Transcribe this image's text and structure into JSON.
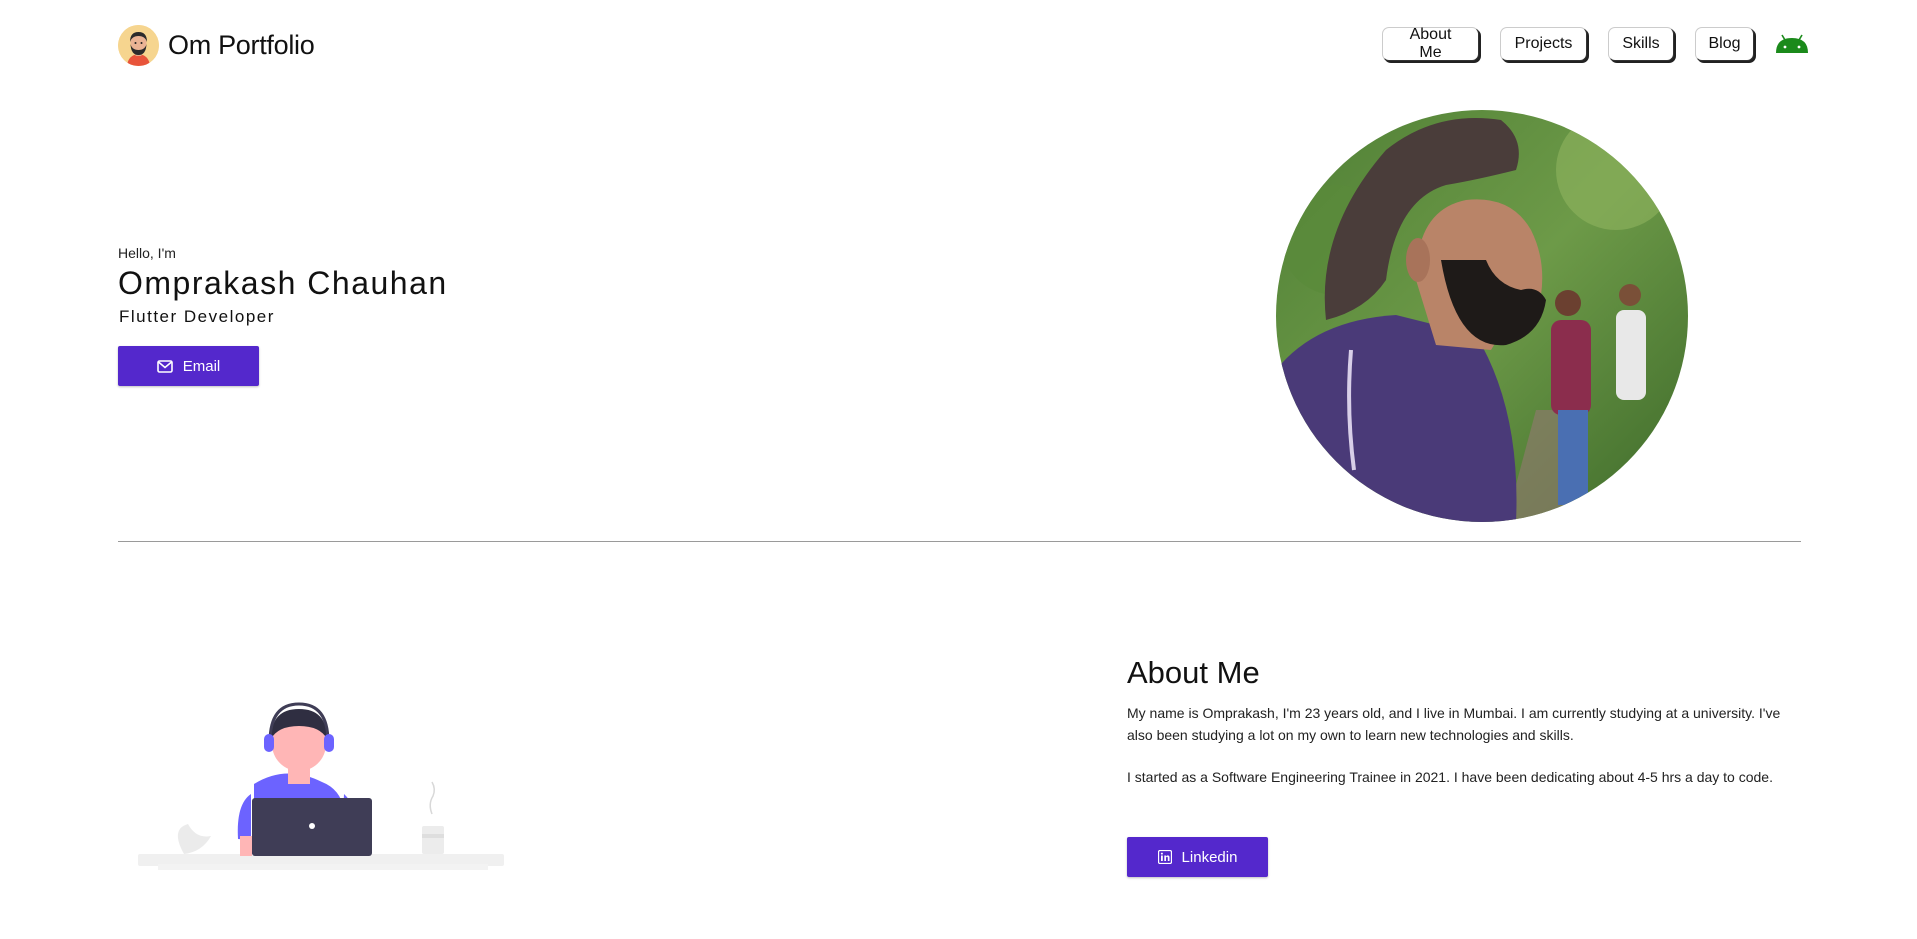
{
  "header": {
    "brand_name": "Om Portfolio",
    "nav": [
      {
        "label": "About Me"
      },
      {
        "label": "Projects"
      },
      {
        "label": "Skills"
      },
      {
        "label": "Blog"
      }
    ]
  },
  "hero": {
    "greeting": "Hello, I'm",
    "name": "Omprakash Chauhan",
    "role": "Flutter Developer",
    "email_button": "Email"
  },
  "about": {
    "title": "About Me",
    "paragraph_1": "My name is Omprakash, I'm 23 years old, and I live in Mumbai. I am currently studying at a university. I've also been studying a lot on my own to learn new technologies and skills.",
    "paragraph_2": "I started as a Software Engineering Trainee in 2021. I have been dedicating about 4-5 hrs a day to code.",
    "linkedin_button": "Linkedin"
  },
  "colors": {
    "accent": "#5428cc",
    "android": "#1b8a1b",
    "illustration_purple": "#6c63ff",
    "laptop": "#3f3d56"
  },
  "icons": {
    "logo": "avatar-icon",
    "nav_extra": "android-icon",
    "email": "mail-icon",
    "linkedin": "linkedin-icon"
  }
}
